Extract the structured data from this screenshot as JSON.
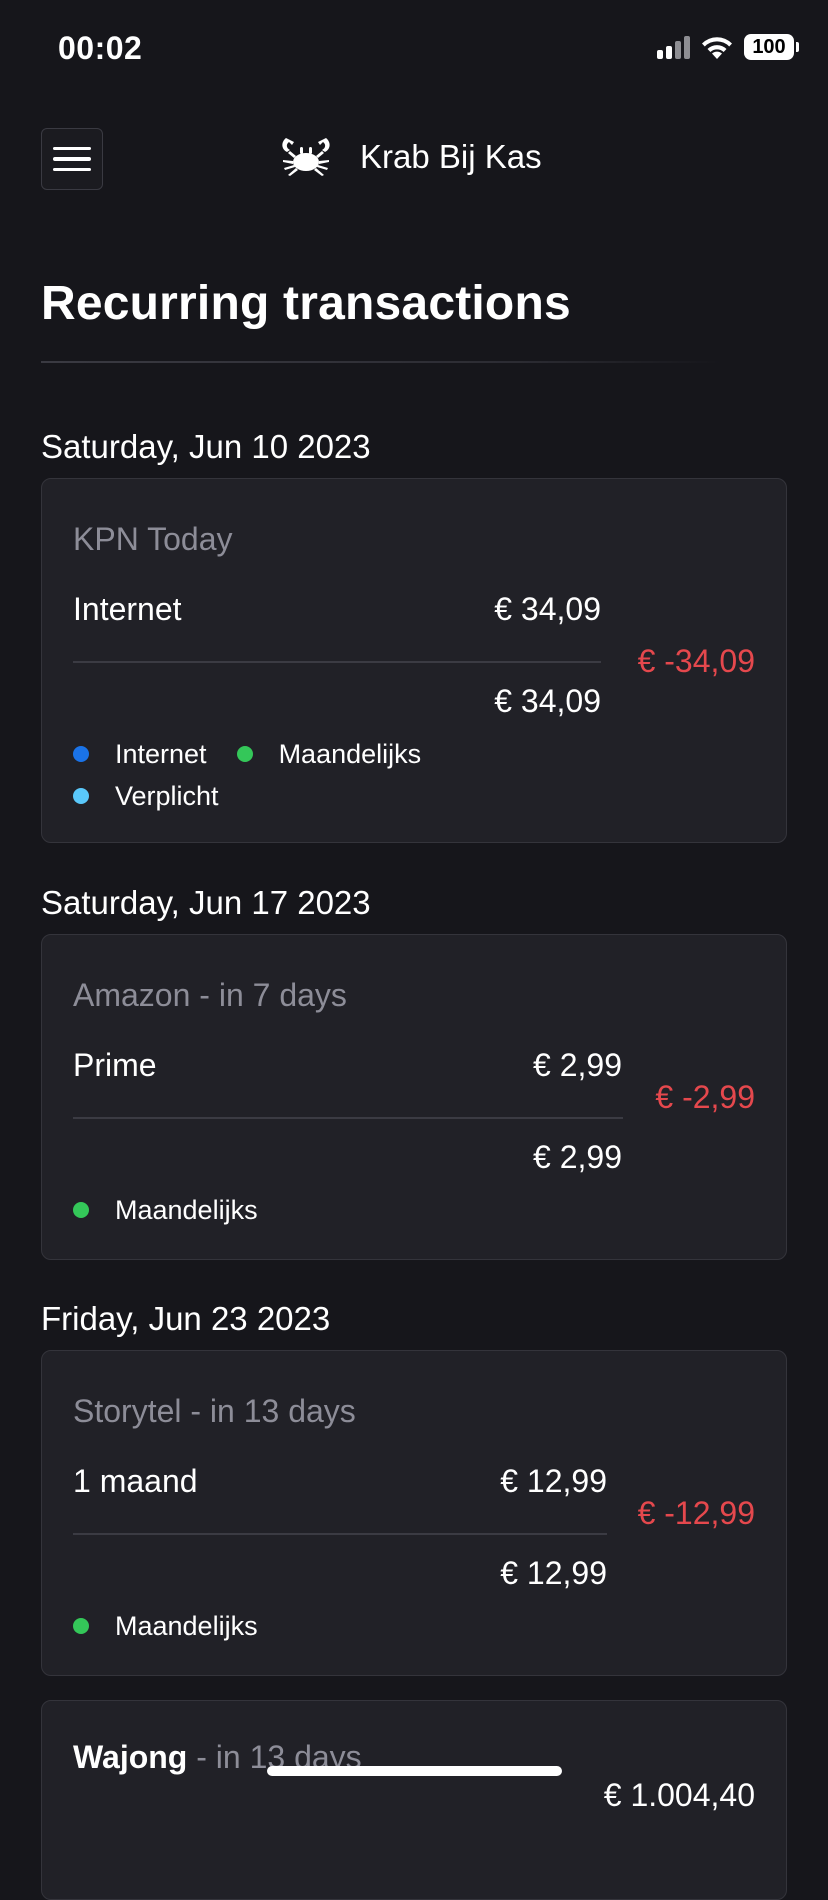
{
  "status_bar": {
    "time": "00:02",
    "battery": "100"
  },
  "header": {
    "menu_icon": "hamburger-menu-icon",
    "logo_icon": "crab-icon",
    "brand": "Krab Bij Kas"
  },
  "page": {
    "title": "Recurring transactions"
  },
  "colors": {
    "background": "#16161b",
    "card": "#212127",
    "negative": "#e5484d",
    "muted": "#8d8d98",
    "tag_internet": "#1a73e8",
    "tag_monthly": "#34c759",
    "tag_required": "#5ac8fa"
  },
  "groups": [
    {
      "date": "Saturday, Jun 10 2023",
      "merchant": "KPN Today",
      "item": "Internet",
      "item_amount": "€ 34,09",
      "subtotal": "€ 34,09",
      "total": "€ -34,09",
      "tags": [
        "Internet",
        "Maandelijks",
        "Verplicht"
      ]
    },
    {
      "date": "Saturday, Jun 17 2023",
      "merchant": "Amazon - in 7 days",
      "item": "Prime",
      "item_amount": "€ 2,99",
      "subtotal": "€ 2,99",
      "total": "€ -2,99",
      "tags": [
        "Maandelijks"
      ]
    },
    {
      "date": "Friday, Jun 23 2023",
      "merchant": "Storytel - in 13 days",
      "item": "1 maand",
      "item_amount": "€ 12,99",
      "subtotal": "€ 12,99",
      "total": "€ -12,99",
      "tags": [
        "Maandelijks"
      ]
    },
    {
      "merchant_name": "Wajong",
      "merchant_suffix": " - in 13 days",
      "partial_amount": "€ 1.004,40"
    }
  ]
}
